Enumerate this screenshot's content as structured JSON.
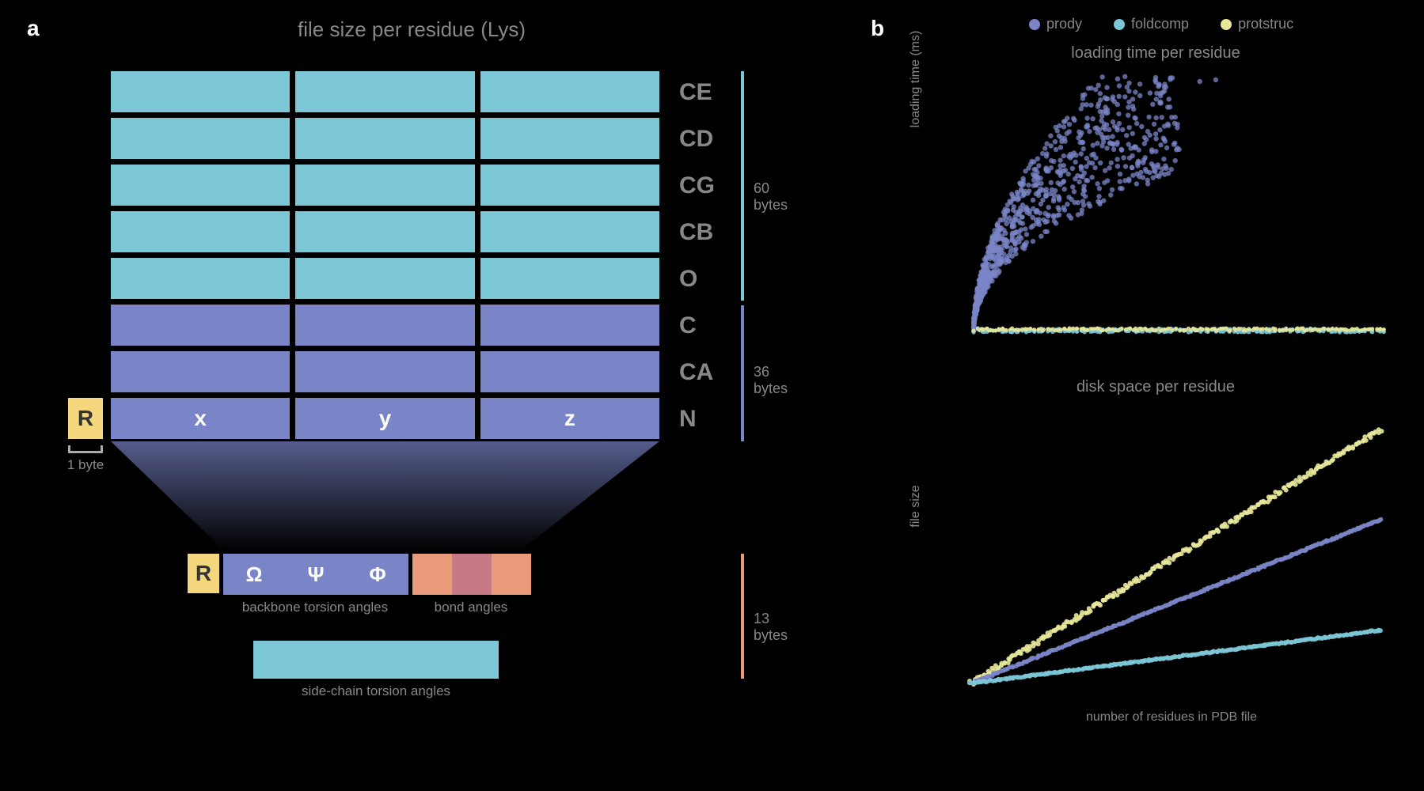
{
  "panels": {
    "a": "a",
    "b": "b"
  },
  "left": {
    "title": "file size per residue (Lys)",
    "atom_rows": [
      "CE",
      "CD",
      "CG",
      "CB",
      "O",
      "C",
      "CA",
      "N"
    ],
    "coords": {
      "x": "x",
      "y": "y",
      "z": "z"
    },
    "r_label": "R",
    "r_sub": "1 byte",
    "bytes_upper": "60 bytes",
    "bytes_mid": "36 bytes",
    "bytes_lower": "13 bytes",
    "torsion": {
      "omega": "Ω",
      "psi": "Ψ",
      "phi": "Φ"
    },
    "labels": {
      "backbone": "backbone torsion angles",
      "bond": "bond angles",
      "sidechain": "side-chain torsion angles"
    }
  },
  "right": {
    "top_title": "loading time per residue",
    "bottom_title": "disk space per residue",
    "x_axis": "number of residues in PDB file",
    "y_axis_top": "loading time (ms)",
    "y_axis_bottom": "file size",
    "legend": [
      {
        "name": "prody",
        "color": "#7a85c7"
      },
      {
        "name": "foldcomp",
        "color": "#7cc7d6"
      },
      {
        "name": "protstruc",
        "color": "#e8e89a"
      }
    ]
  },
  "colors": {
    "light": "#7cc7d6",
    "dark": "#7a85c7",
    "salmon": "#e89a7a",
    "salmon_dark": "#c77a85",
    "yellow": "#f5d77e",
    "green": "#e8e89a"
  },
  "chart_data": [
    {
      "type": "scatter",
      "title": "loading time per residue",
      "xlabel": "number of residues in PDB file",
      "ylabel": "loading time (ms)",
      "series": [
        {
          "name": "prody",
          "color": "#7a85c7",
          "shape": "rising-cloud",
          "note": "steep curve rising superlinearly, spread from near origin upward, outliers near top-right"
        },
        {
          "name": "foldcomp",
          "color": "#7cc7d6",
          "shape": "flat-near-zero",
          "note": "near-zero loading time across all residue counts, hugging the x-axis"
        },
        {
          "name": "protstruc",
          "color": "#e8e89a",
          "shape": "flat-near-zero",
          "note": "near-zero loading time across all residue counts, hugging the x-axis"
        }
      ]
    },
    {
      "type": "scatter",
      "title": "disk space per residue",
      "xlabel": "number of residues in PDB file",
      "ylabel": "file size",
      "series": [
        {
          "name": "protstruc",
          "color": "#e8e89a",
          "shape": "linear-steep",
          "note": "steepest slope, largest file size per residue"
        },
        {
          "name": "prody",
          "color": "#7a85c7",
          "shape": "linear-mid",
          "note": "middle slope"
        },
        {
          "name": "foldcomp",
          "color": "#7cc7d6",
          "shape": "linear-shallow",
          "note": "shallowest slope, smallest file size per residue"
        }
      ]
    }
  ]
}
